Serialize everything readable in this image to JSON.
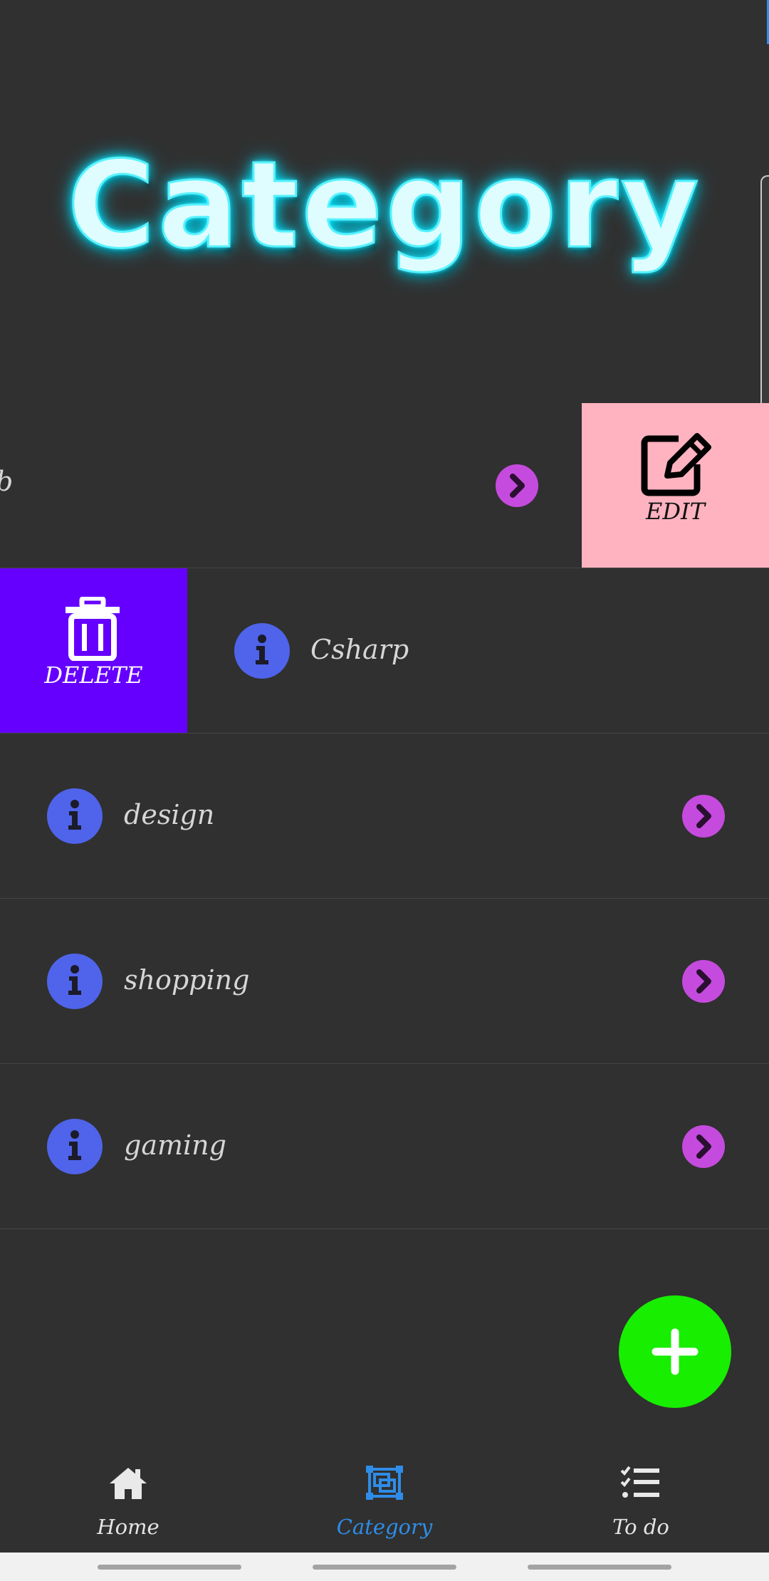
{
  "header": {
    "title": "Category"
  },
  "categories": [
    {
      "label": "b"
    },
    {
      "label": "Csharp"
    },
    {
      "label": "design"
    },
    {
      "label": "shopping"
    },
    {
      "label": "gaming"
    }
  ],
  "swipe_actions": {
    "edit_label": "EDIT",
    "delete_label": "DELETE"
  },
  "fab": {
    "icon": "plus-icon"
  },
  "bottom_nav": {
    "items": [
      {
        "label": "Home",
        "icon": "home-icon"
      },
      {
        "label": "Category",
        "icon": "category-icon"
      },
      {
        "label": "To do",
        "icon": "checklist-icon"
      }
    ],
    "active": "Category"
  },
  "colors": {
    "background": "#303030",
    "title_glow": "#00e5ff",
    "info_icon": "#4f64ea",
    "chevron": "#c54bde",
    "edit_action": "#ffb3c0",
    "delete_action": "#6500ff",
    "fab": "#17ee00",
    "nav_active": "#2e8de8"
  }
}
